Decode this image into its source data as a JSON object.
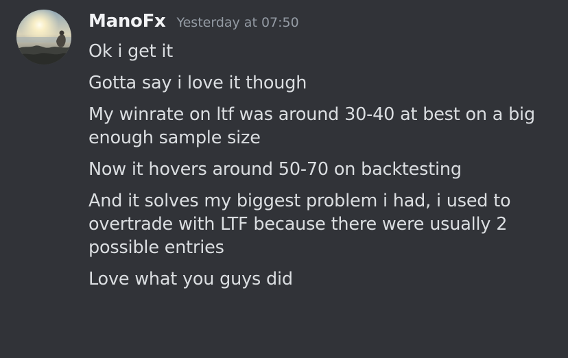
{
  "message_group": {
    "author": {
      "name": "ManoFx",
      "avatar": "user-avatar-sunset-beach"
    },
    "timestamp": "Yesterday at 07:50",
    "messages": [
      "Ok i get it",
      "Gotta say i love it though",
      "My winrate on ltf was around 30-40 at best on a big enough sample size",
      "Now it hovers around 50-70 on backtesting",
      "And it solves my biggest problem i had, i used to overtrade with LTF because there were usually 2 possible entries",
      "Love what you guys did"
    ]
  },
  "colors": {
    "background": "#313338",
    "username": "#f2f3f5",
    "timestamp": "#949ba4",
    "message_text": "#dbdee1"
  }
}
